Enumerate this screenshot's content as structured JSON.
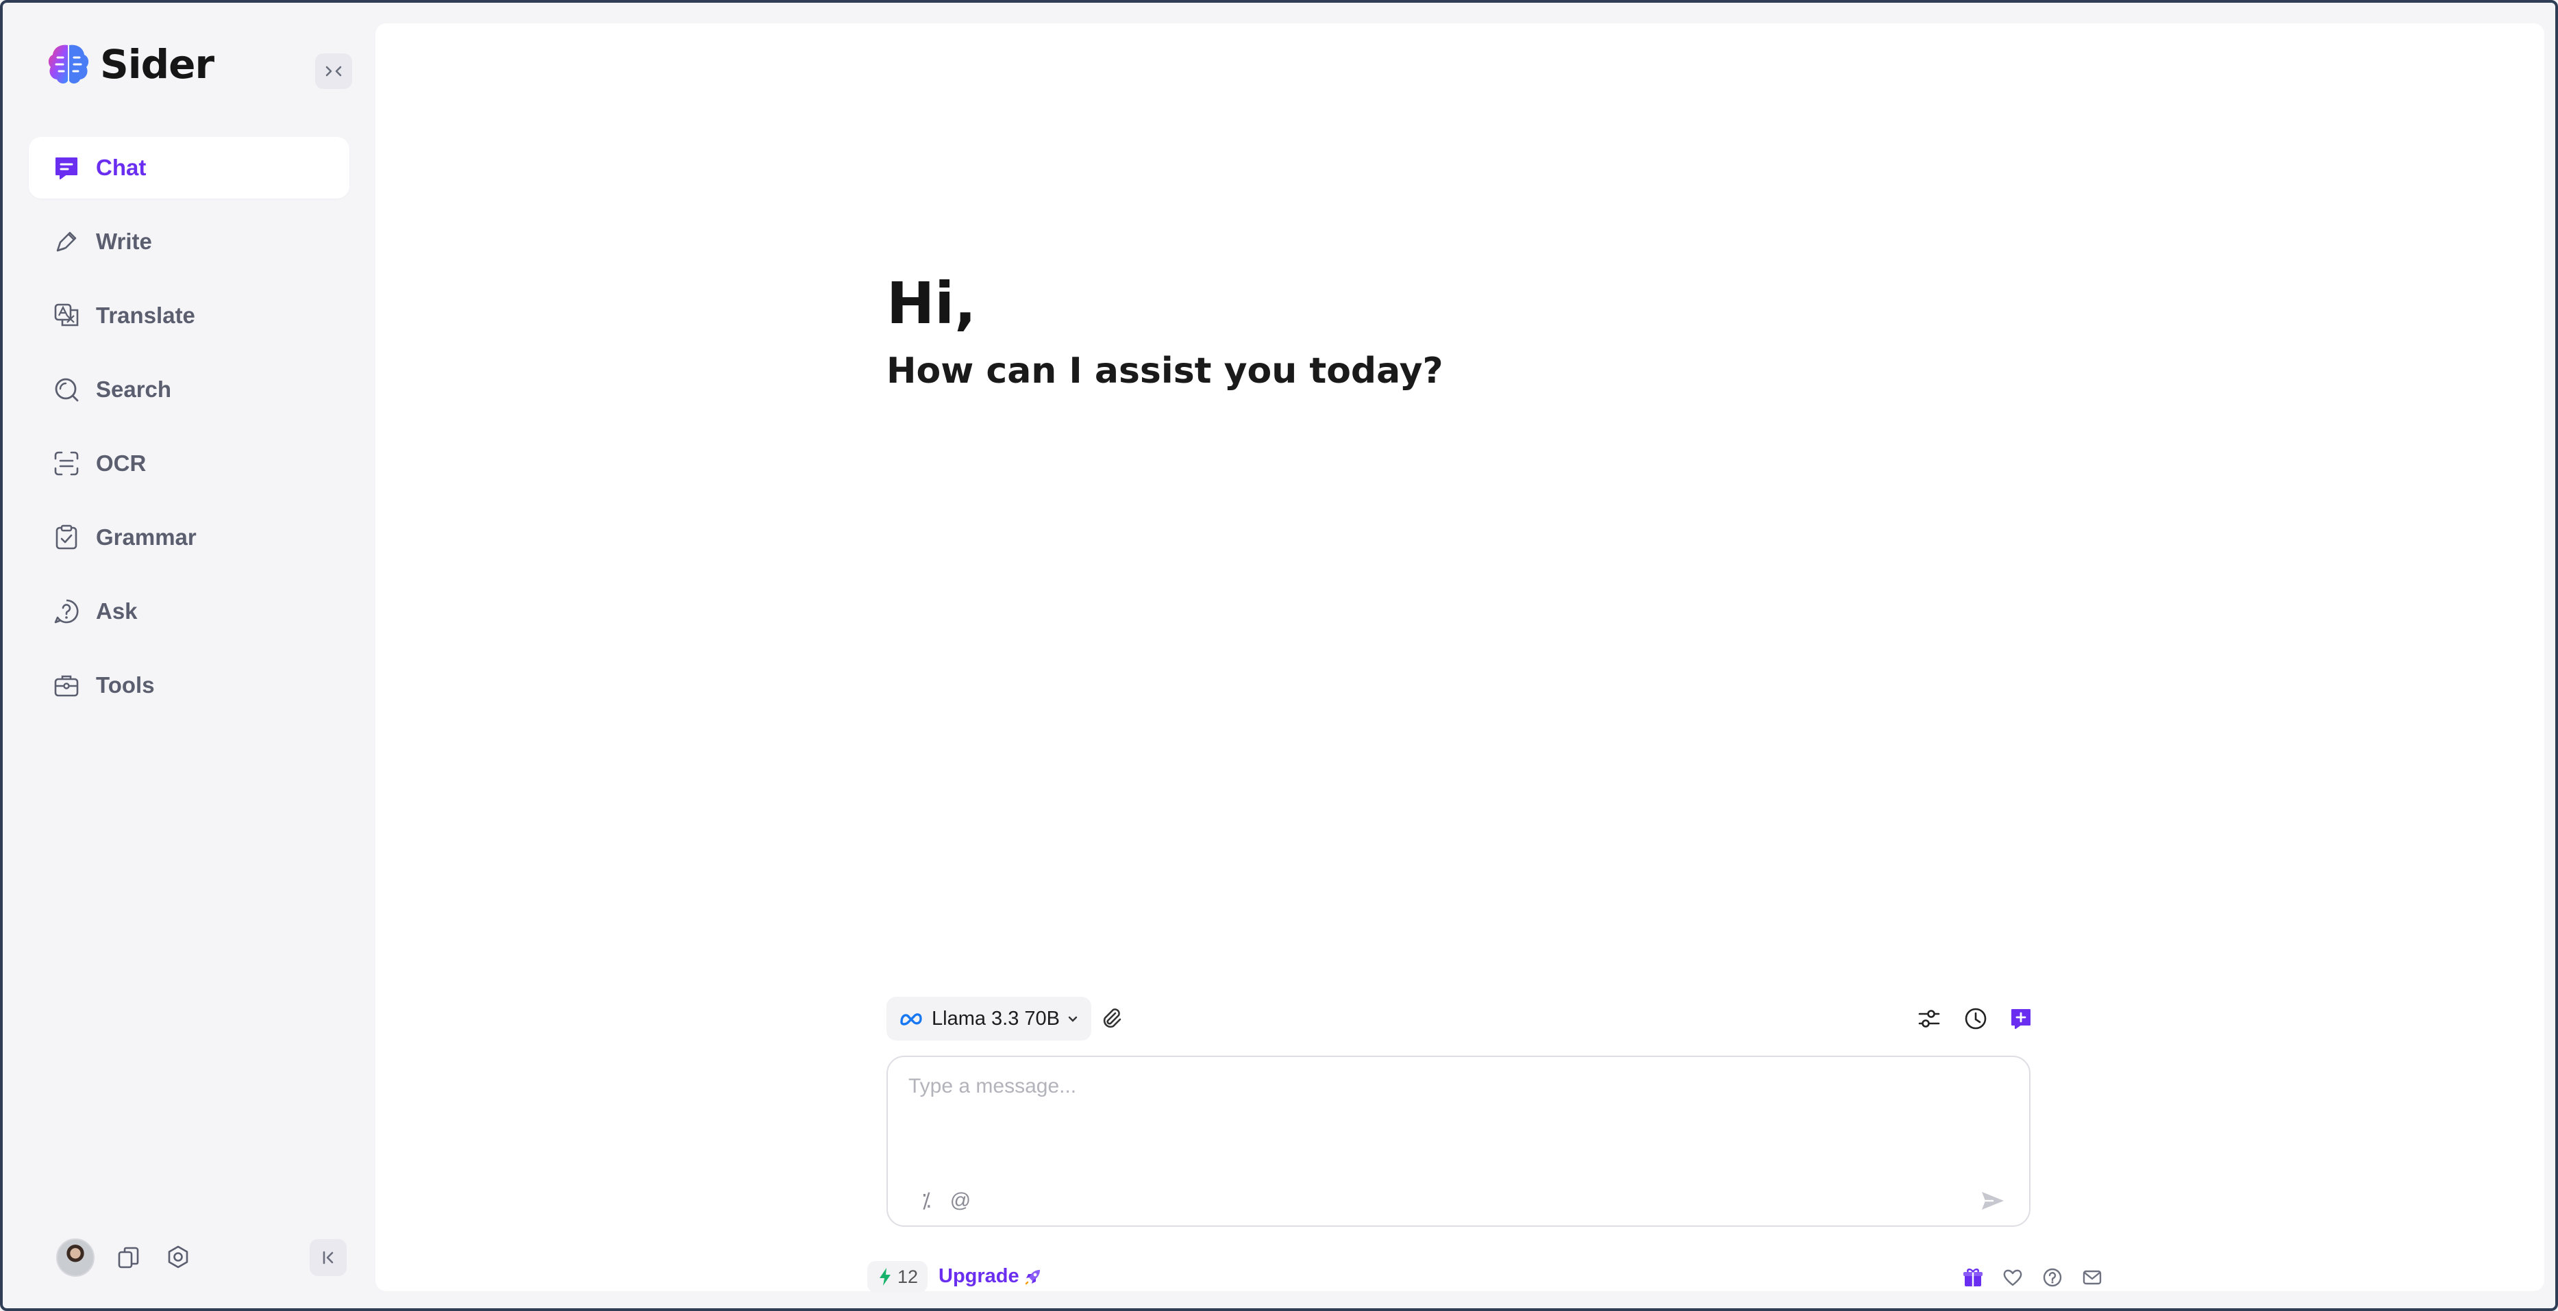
{
  "app": {
    "name": "Sider"
  },
  "sidebar": {
    "items": [
      {
        "label": "Chat",
        "icon": "chat-icon",
        "active": true
      },
      {
        "label": "Write",
        "icon": "pen-icon"
      },
      {
        "label": "Translate",
        "icon": "translate-icon"
      },
      {
        "label": "Search",
        "icon": "search-icon"
      },
      {
        "label": "OCR",
        "icon": "ocr-scan-icon"
      },
      {
        "label": "Grammar",
        "icon": "clipboard-check-icon"
      },
      {
        "label": "Ask",
        "icon": "question-icon"
      },
      {
        "label": "Tools",
        "icon": "toolbox-icon"
      }
    ]
  },
  "greeting": {
    "title": "Hi,",
    "subtitle": "How can I assist you today?"
  },
  "composer": {
    "model": "Llama 3.3 70B",
    "placeholder": "Type a message...",
    "prompt_shortcut": "⁒",
    "mention_shortcut": "@"
  },
  "footer": {
    "credits": "12",
    "upgrade_label": "Upgrade"
  },
  "colors": {
    "accent": "#6a2ef0",
    "sidebar_bg": "#f5f5f8",
    "frame": "#2f3e55"
  }
}
